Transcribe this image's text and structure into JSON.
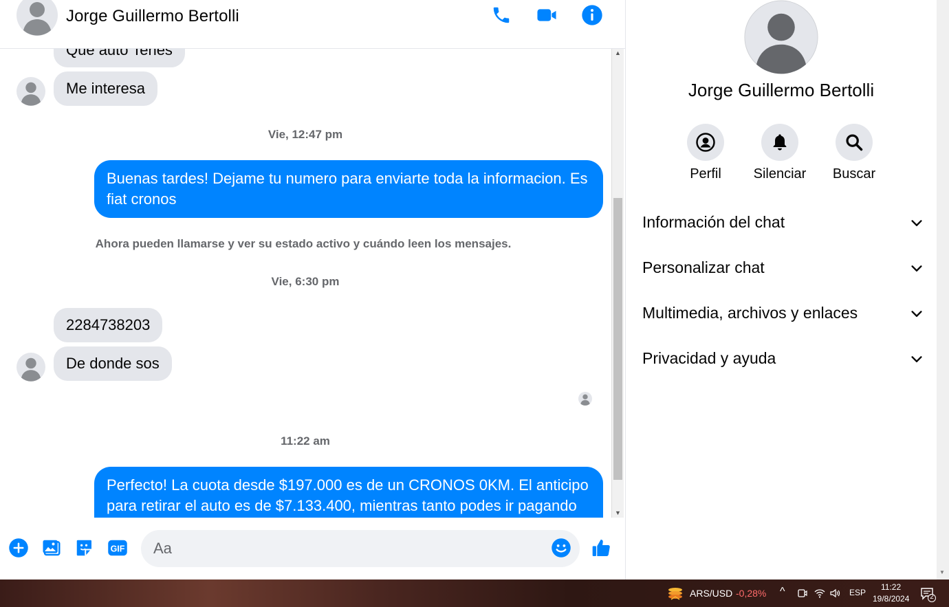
{
  "header": {
    "contact_name": "Jorge Guillermo Bertolli"
  },
  "messages": {
    "partial_top": "Que auto Tenes",
    "in1": "Me interesa",
    "ts1": "Vie, 12:47 pm",
    "out1": "Buenas tardes! Dejame tu numero para enviarte toda la informacion. Es fiat cronos",
    "system": "Ahora pueden llamarse y ver su estado activo y cuándo leen los mensajes.",
    "ts2": "Vie, 6:30 pm",
    "in2": "2284738203",
    "in3": "De donde sos",
    "ts3": "11:22 am",
    "out2": "Perfecto! La cuota desde $197.000 es de un CRONOS 0KM. El anticipo para retirar el auto es de $7.133.400, mientras tanto podes ir pagando"
  },
  "composer": {
    "placeholder": "Aa"
  },
  "sidebar": {
    "name": "Jorge Guillermo Bertolli",
    "actions": [
      {
        "label": "Perfil",
        "icon": "profile-icon"
      },
      {
        "label": "Silenciar",
        "icon": "bell-icon"
      },
      {
        "label": "Buscar",
        "icon": "search-icon"
      }
    ],
    "sections": [
      {
        "label": "Información del chat"
      },
      {
        "label": "Personalizar chat"
      },
      {
        "label": "Multimedia, archivos y enlaces"
      },
      {
        "label": "Privacidad y ayuda"
      }
    ]
  },
  "taskbar": {
    "ticker_label": "ARS/USD",
    "ticker_change": "-0,28%",
    "language": "ESP",
    "time": "11:22",
    "date": "19/8/2024",
    "notification_count": "2"
  },
  "colors": {
    "accent": "#0084ff",
    "bubble_in": "#e4e6eb",
    "negative": "#ff6b6b"
  }
}
